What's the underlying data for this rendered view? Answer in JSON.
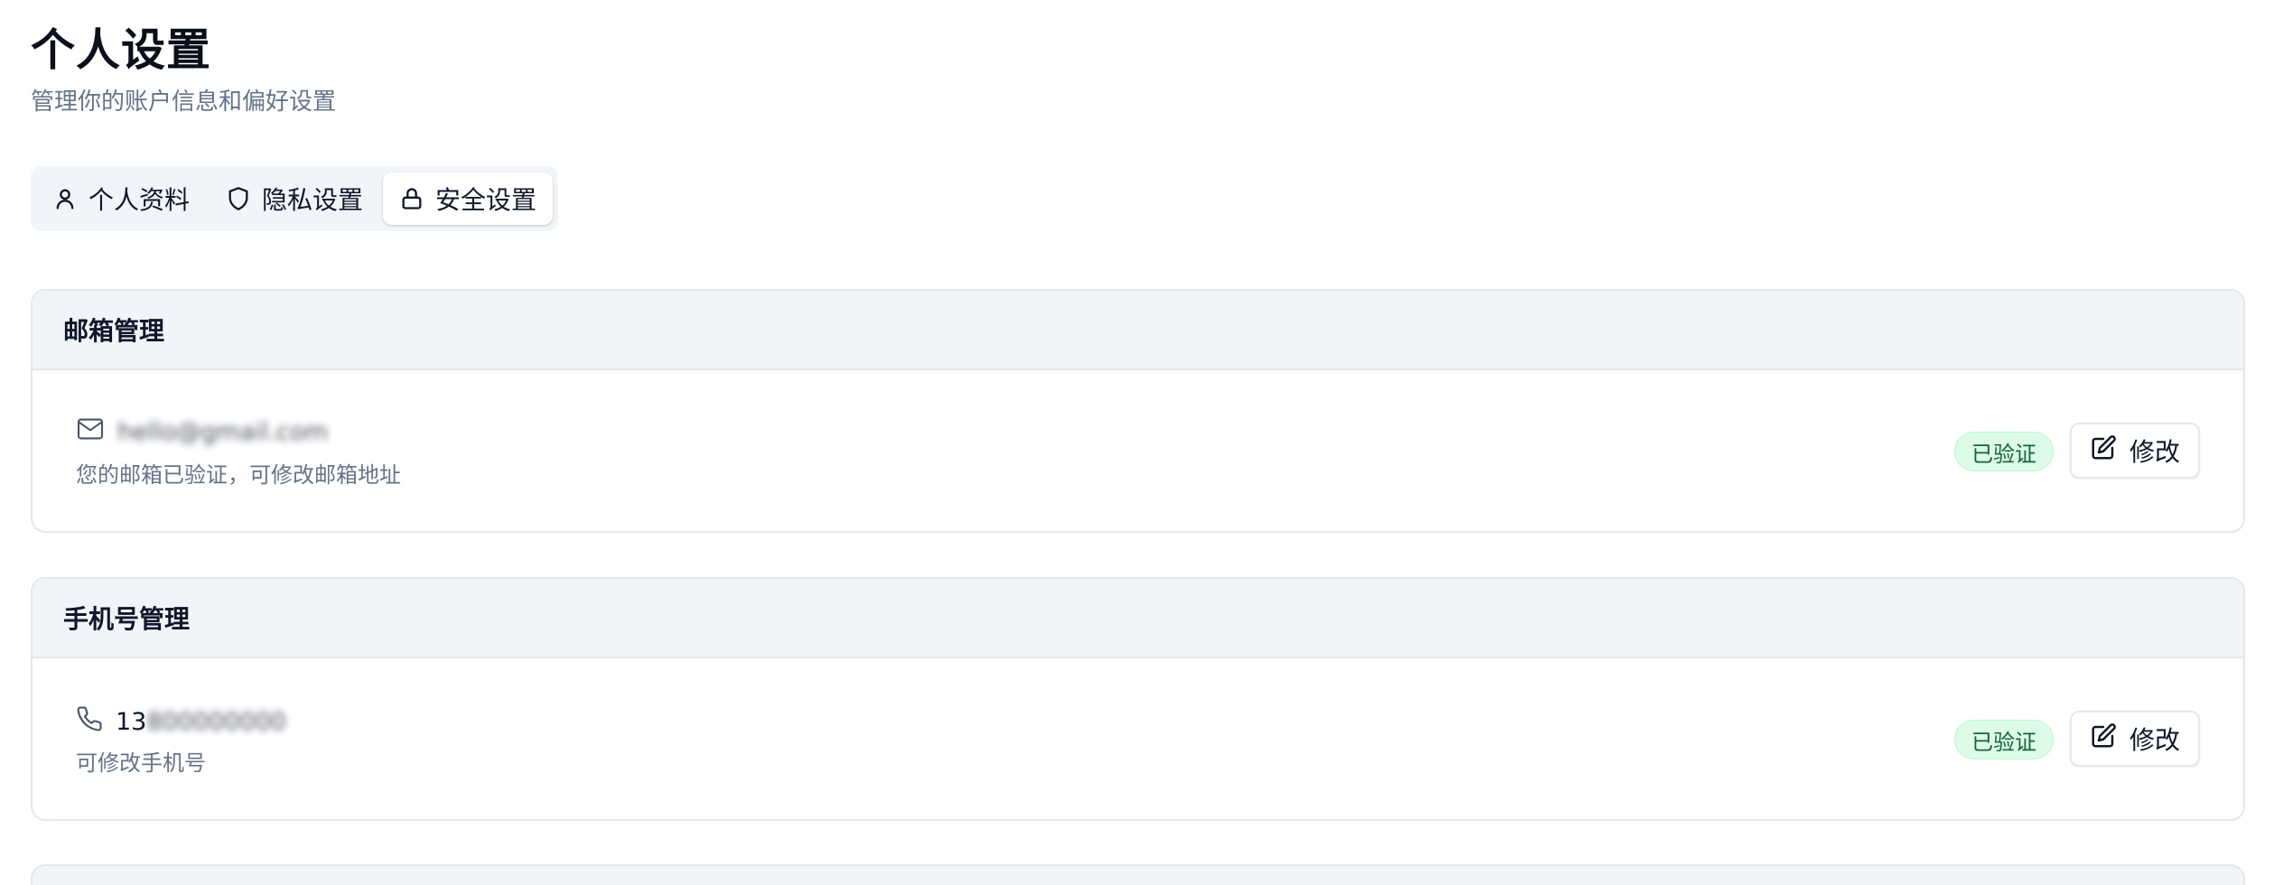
{
  "header": {
    "title": "个人设置",
    "subtitle": "管理你的账户信息和偏好设置"
  },
  "tabs": [
    {
      "label": "个人资料",
      "icon": "user-icon",
      "active": false
    },
    {
      "label": "隐私设置",
      "icon": "shield-icon",
      "active": false
    },
    {
      "label": "安全设置",
      "icon": "lock-icon",
      "active": true
    }
  ],
  "email_section": {
    "title": "邮箱管理",
    "value": "hello@gmail.com",
    "description": "您的邮箱已验证，可修改邮箱地址",
    "status": "已验证",
    "edit_label": "修改",
    "icon": "mail-icon"
  },
  "phone_section": {
    "title": "手机号管理",
    "value_prefix": "13",
    "value_masked": "800000000",
    "description": "可修改手机号",
    "status": "已验证",
    "edit_label": "修改",
    "icon": "phone-icon"
  },
  "colors": {
    "accent_bg": "#f1f5f9",
    "verified_bg": "#dcfce7",
    "verified_text": "#166534",
    "muted_text": "#64748b"
  }
}
